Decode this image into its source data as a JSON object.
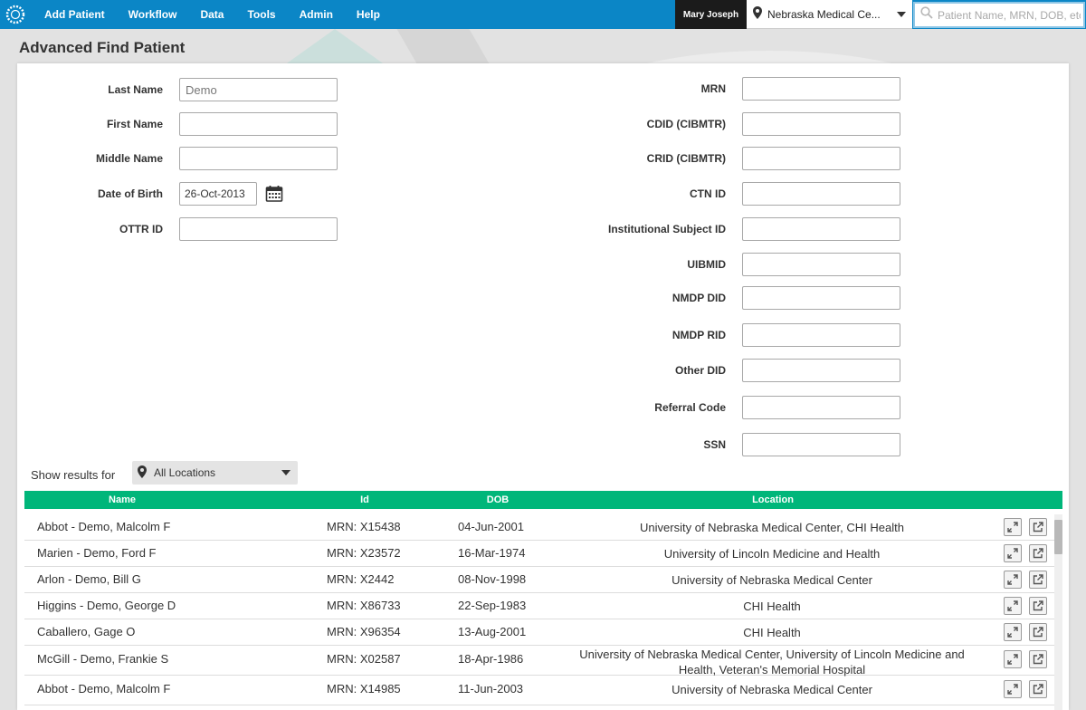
{
  "nav": {
    "items": [
      "Add Patient",
      "Workflow",
      "Data",
      "Tools",
      "Admin",
      "Help"
    ],
    "user": "Mary Joseph",
    "location": "Nebraska Medical Ce...",
    "search_placeholder": "Patient Name, MRN, DOB, etc."
  },
  "page": {
    "title": "Advanced Find Patient"
  },
  "form": {
    "left": [
      {
        "label": "Last Name",
        "placeholder": "Demo",
        "value": ""
      },
      {
        "label": "First Name",
        "placeholder": "",
        "value": ""
      },
      {
        "label": "Middle Name",
        "placeholder": "",
        "value": ""
      },
      {
        "label": "Date of Birth",
        "placeholder": "",
        "value": "26-Oct-2013"
      },
      {
        "label": "OTTR ID",
        "placeholder": "",
        "value": ""
      }
    ],
    "right": [
      {
        "label": "MRN",
        "value": ""
      },
      {
        "label": "CDID (CIBMTR)",
        "value": ""
      },
      {
        "label": "CRID (CIBMTR)",
        "value": ""
      },
      {
        "label": "CTN ID",
        "value": ""
      },
      {
        "label": "Institutional Subject ID",
        "value": ""
      },
      {
        "label": "UIBMID",
        "value": ""
      },
      {
        "label": "NMDP DID",
        "value": ""
      },
      {
        "label": "NMDP RID",
        "value": ""
      },
      {
        "label": "Other DID",
        "value": ""
      },
      {
        "label": "Referral Code",
        "value": ""
      },
      {
        "label": "SSN",
        "value": ""
      }
    ]
  },
  "results": {
    "show_label": "Show results for",
    "location_filter": "All Locations",
    "columns": [
      "Name",
      "Id",
      "DOB",
      "Location"
    ],
    "rows": [
      {
        "name": "Abbot - Demo, Malcolm F",
        "id": "MRN: X15438",
        "dob": "04-Jun-2001",
        "location": "University of Nebraska Medical Center, CHI Health"
      },
      {
        "name": "Marien - Demo, Ford F",
        "id": "MRN: X23572",
        "dob": "16-Mar-1974",
        "location": "University of Lincoln Medicine and Health"
      },
      {
        "name": "Arlon - Demo, Bill G",
        "id": "MRN: X2442",
        "dob": "08-Nov-1998",
        "location": "University of Nebraska Medical Center"
      },
      {
        "name": "Higgins - Demo, George D",
        "id": "MRN: X86733",
        "dob": "22-Sep-1983",
        "location": "CHI Health"
      },
      {
        "name": "Caballero, Gage O",
        "id": "MRN: X96354",
        "dob": "13-Aug-2001",
        "location": "CHI Health"
      },
      {
        "name": "McGill - Demo, Frankie S",
        "id": "MRN: X02587",
        "dob": "18-Apr-1986",
        "location": "University of Nebraska Medical Center, University of Lincoln Medicine and Health, Veteran's Memorial Hospital"
      },
      {
        "name": "Abbot - Demo, Malcolm F",
        "id": "MRN: X14985",
        "dob": "11-Jun-2003",
        "location": "University of Nebraska Medical Center"
      }
    ]
  },
  "icons": {
    "logo": "logo-icon",
    "pin": "map-pin-icon",
    "search": "search-icon",
    "calendar": "calendar-icon",
    "row_actions": [
      "switch-patient-icon",
      "open-new-window-icon"
    ]
  },
  "colors": {
    "nav_bg": "#0b86c6",
    "table_header": "#00b67a",
    "user_box": "#1b1b1b"
  }
}
